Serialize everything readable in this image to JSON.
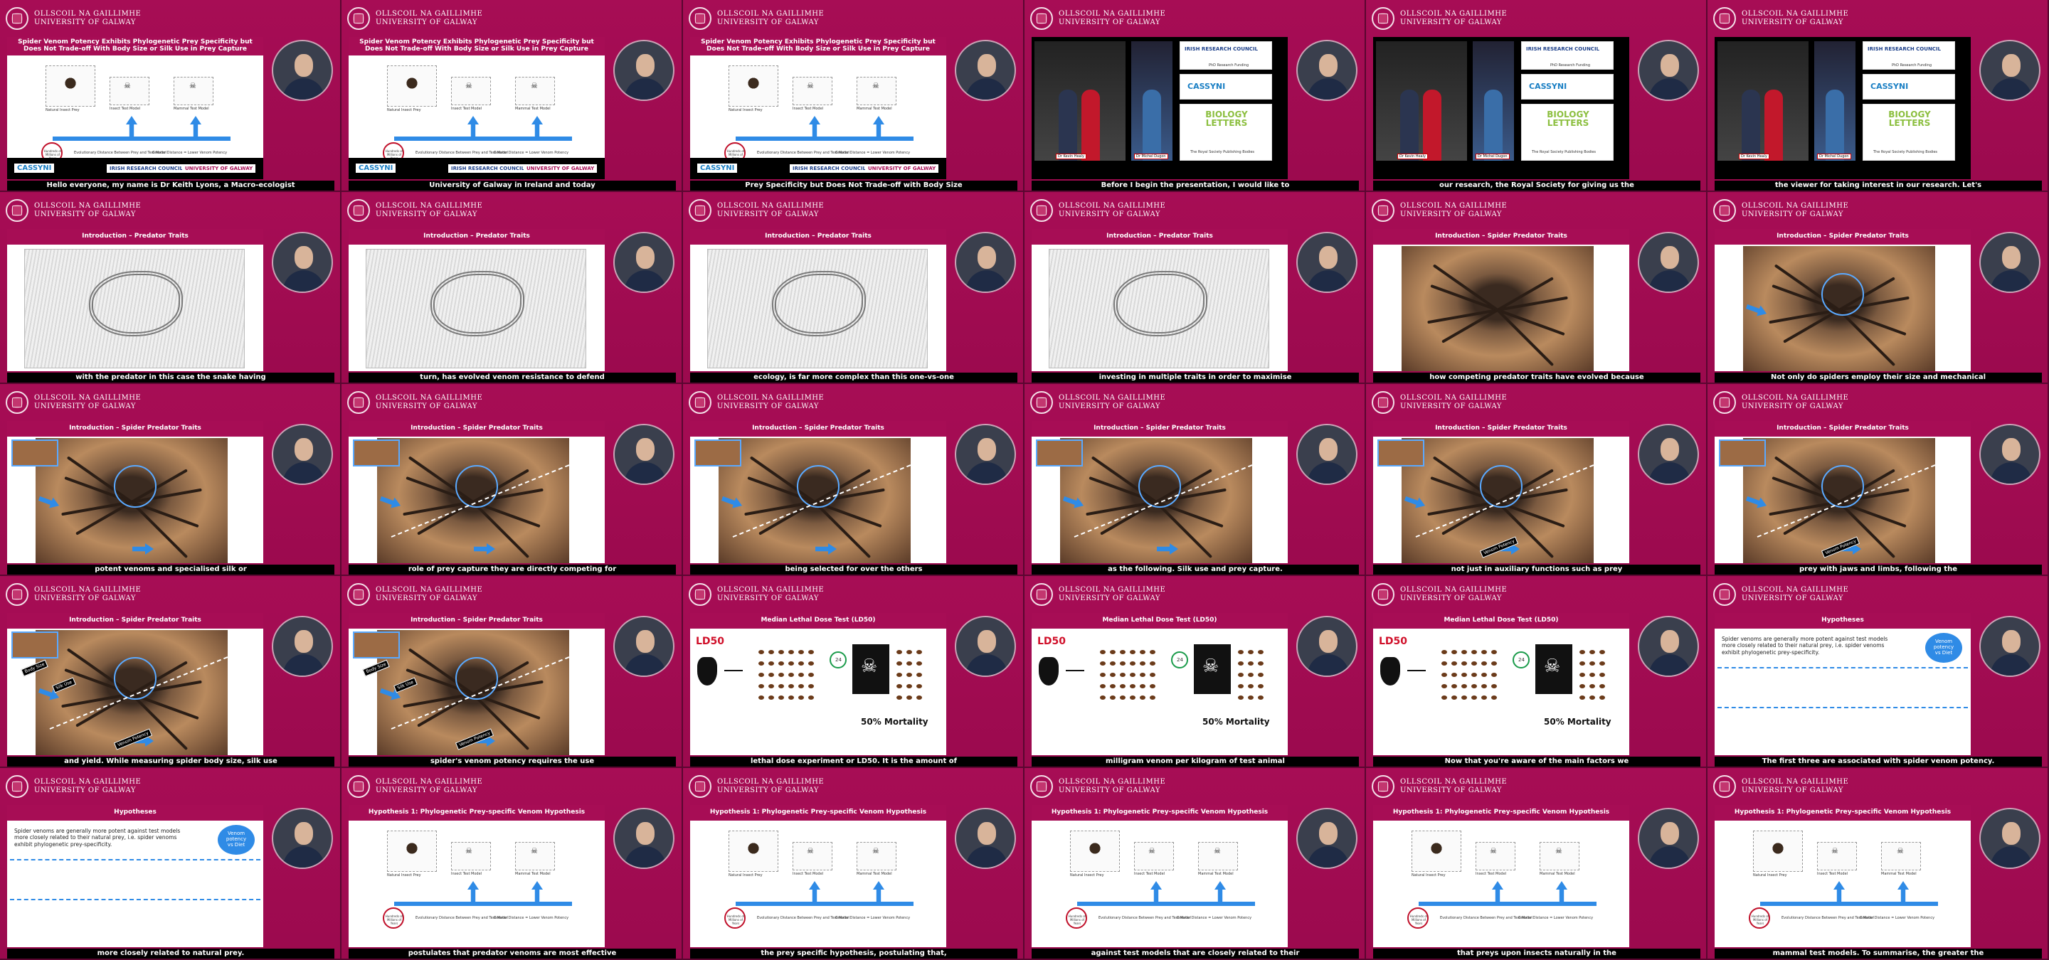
{
  "logo": {
    "line1": "OLLSCOIL NA GAILLIMHE",
    "line2": "UNIVERSITY OF GALWAY"
  },
  "frames": [
    {
      "kind": "title",
      "title": "Spider Venom Potency Exhibits Phylogenetic Prey Specificity but Does Not Trade-off With Body Size or Silk Use in Prey Capture",
      "caption": "Hello everyone, my name is Dr Keith Lyons, a Macro-ecologist"
    },
    {
      "kind": "title",
      "title": "Spider Venom Potency Exhibits Phylogenetic Prey Specificity but Does Not Trade-off With Body Size or Silk Use in Prey Capture",
      "caption": "University of Galway in Ireland and today"
    },
    {
      "kind": "title",
      "title": "Spider Venom Potency Exhibits Phylogenetic Prey Specificity but Does Not Trade-off With Body Size or Silk Use in Prey Capture",
      "caption": "Prey Specificity but Does Not Trade-off with Body Size"
    },
    {
      "kind": "ack",
      "title": "",
      "caption": "Before I begin the presentation, I would like to"
    },
    {
      "kind": "ack",
      "title": "",
      "caption": "our research, the Royal Society for giving us the"
    },
    {
      "kind": "ack",
      "title": "",
      "caption": "the viewer for taking interest in our research. Let's"
    },
    {
      "kind": "sketch",
      "title": "Introduction – Predator Traits",
      "caption": "with the predator in this case the snake having"
    },
    {
      "kind": "sketch",
      "title": "Introduction – Predator Traits",
      "caption": "turn, has evolved venom resistance to defend"
    },
    {
      "kind": "sketch",
      "title": "Introduction – Predator Traits",
      "caption": "ecology, is far more complex than this one-vs-one"
    },
    {
      "kind": "sketch",
      "title": "Introduction – Predator Traits",
      "caption": "investing in multiple traits in order to maximise"
    },
    {
      "kind": "spider0",
      "title": "Introduction – Spider Predator Traits",
      "caption": "how competing predator traits have evolved because"
    },
    {
      "kind": "spider1",
      "title": "Introduction – Spider Predator Traits",
      "caption": "Not only do spiders employ their size and mechanical"
    },
    {
      "kind": "spider2",
      "title": "Introduction – Spider Predator Traits",
      "caption": "potent venoms and specialised silk or"
    },
    {
      "kind": "spider3",
      "title": "Introduction – Spider Predator Traits",
      "caption": "role of prey capture they are directly competing for"
    },
    {
      "kind": "spider3",
      "title": "Introduction – Spider Predator Traits",
      "caption": "being selected for over the others"
    },
    {
      "kind": "spider3",
      "title": "Introduction – Spider Predator Traits",
      "caption": "as the following. Silk use and prey capture."
    },
    {
      "kind": "spider4",
      "title": "Introduction – Spider Predator Traits",
      "caption": "not just in auxiliary functions such as prey"
    },
    {
      "kind": "spider4",
      "title": "Introduction – Spider Predator Traits",
      "caption": "prey with jaws and limbs, following the"
    },
    {
      "kind": "spider5",
      "title": "Introduction – Spider Predator Traits",
      "caption": "and yield. While measuring spider body size, silk use"
    },
    {
      "kind": "spider5",
      "title": "Introduction – Spider Predator Traits",
      "caption": "spider's venom potency requires the use"
    },
    {
      "kind": "ld50",
      "title": "Median Lethal Dose Test (LD50)",
      "caption": "lethal dose experiment or LD50. It is the amount of"
    },
    {
      "kind": "ld50",
      "title": "Median Lethal Dose Test (LD50)",
      "caption": "milligram venom per kilogram of test animal"
    },
    {
      "kind": "ld50",
      "title": "Median Lethal Dose Test (LD50)",
      "caption": "Now that you're aware of the main factors we"
    },
    {
      "kind": "hyp",
      "title": "Hypotheses",
      "caption": "The first three are associated with spider venom potency."
    },
    {
      "kind": "hyp",
      "title": "Hypotheses",
      "caption": "more closely related to natural prey."
    },
    {
      "kind": "title",
      "title": "Hypothesis 1: Phylogenetic Prey-specific Venom Hypothesis",
      "caption": "postulates that predator venoms are most effective"
    },
    {
      "kind": "title",
      "title": "Hypothesis 1: Phylogenetic Prey-specific Venom Hypothesis",
      "caption": "the prey specific hypothesis, postulating that,"
    },
    {
      "kind": "title",
      "title": "Hypothesis 1: Phylogenetic Prey-specific Venom Hypothesis",
      "caption": "against test models that are closely related to their"
    },
    {
      "kind": "title",
      "title": "Hypothesis 1: Phylogenetic Prey-specific Venom Hypothesis",
      "caption": "that preys upon insects naturally in the"
    },
    {
      "kind": "title",
      "title": "Hypothesis 1: Phylogenetic Prey-specific Venom Hypothesis",
      "caption": "mammal test models. To summarise, the greater the"
    }
  ],
  "tree_labels": {
    "natural": "Natural Insect Prey",
    "insect": "Insect Test Model",
    "mammal": "Mammal Test Model",
    "hundreds": "Hundreds of Millions of Years",
    "distance": "Evolutionary Distance Between Prey and Test Model",
    "greater": "Greater Distance = Lower Venom Potency"
  },
  "ack": {
    "name1": "Dr Kevin Healy",
    "name2": "Dr Michel Dugon",
    "irc": "IRISH RESEARCH COUNCIL",
    "irc_sub": "PhD Research Funding",
    "cassyni": "CASSYNI",
    "biology": "BIOLOGY LETTERS",
    "royal": "The Royal Society Publishing Bodies"
  },
  "ld": {
    "label": "LD50",
    "mortality": "50% Mortality",
    "time": "24"
  },
  "hyp": {
    "item1": "Spider venoms are generally more potent against test models more closely related to their natural prey, i.e. spider venoms exhibit phylogenetic prey-specificity.",
    "bubble_a": "Venom potency",
    "bubble_b": "vs Diet"
  },
  "spider_labels": {
    "a": "Body Size",
    "b": "Silk Use",
    "c": "Venom Potency"
  },
  "colors": {
    "bg": "#a70d55",
    "accent": "#2f8be6",
    "caption_bg": "#000000"
  }
}
